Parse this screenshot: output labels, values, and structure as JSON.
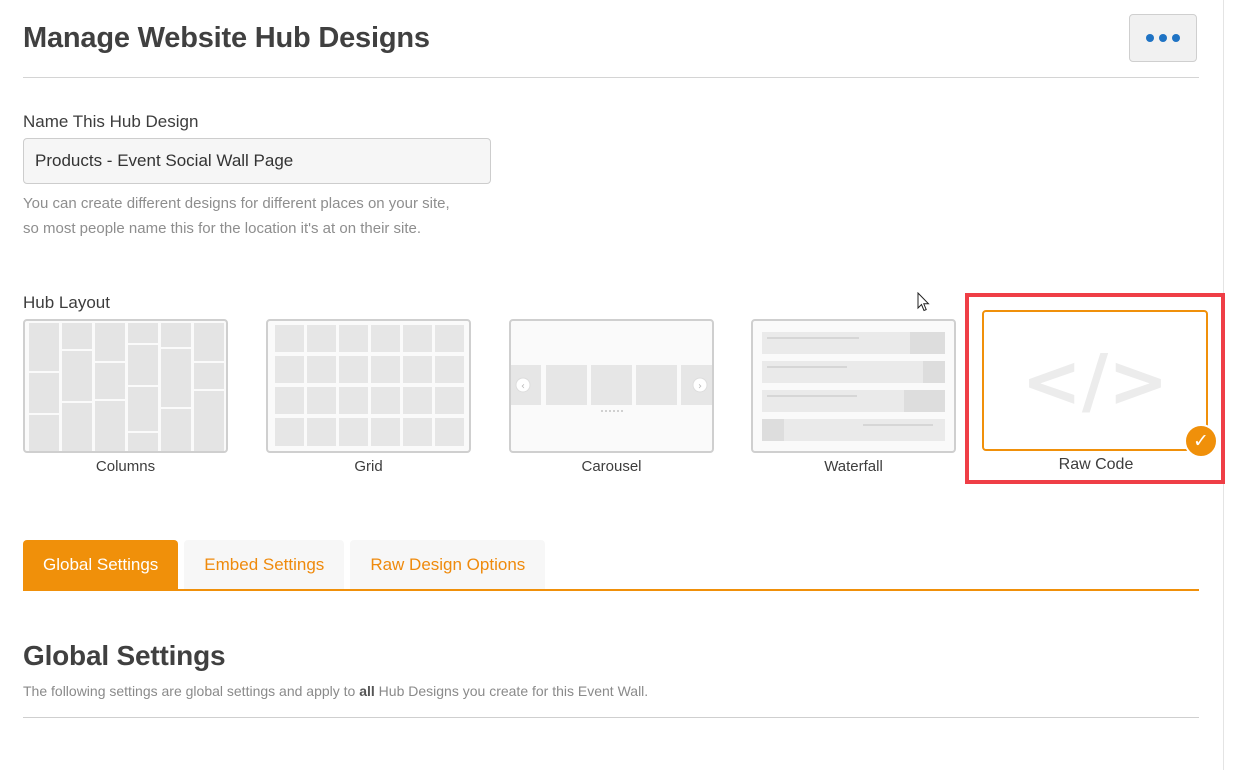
{
  "header": {
    "title": "Manage Website Hub Designs",
    "more_icon": "ellipsis-icon"
  },
  "name_field": {
    "label": "Name This Hub Design",
    "value": "Products - Event Social Wall Page",
    "help_line1": "You can create different designs for different places on your site,",
    "help_line2": "so most people name this for the location it's at on their site."
  },
  "hub_layout": {
    "label": "Hub Layout",
    "options": [
      {
        "label": "Columns",
        "icon": "columns-layout-thumbnail"
      },
      {
        "label": "Grid",
        "icon": "grid-layout-thumbnail"
      },
      {
        "label": "Carousel",
        "icon": "carousel-layout-thumbnail"
      },
      {
        "label": "Waterfall",
        "icon": "waterfall-layout-thumbnail"
      },
      {
        "label": "Raw Code",
        "icon": "code-icon",
        "selected": true
      }
    ],
    "selected_icon": "checkmark-icon"
  },
  "tabs": [
    {
      "label": "Global Settings",
      "active": true
    },
    {
      "label": "Embed Settings",
      "active": false
    },
    {
      "label": "Raw Design Options",
      "active": false
    }
  ],
  "section": {
    "title": "Global Settings",
    "desc_before": "The following settings are global settings and apply to ",
    "desc_bold": "all",
    "desc_after": " Hub Designs you create for this Event Wall."
  },
  "colors": {
    "accent": "#f0900a",
    "highlight": "#ef3e46",
    "link_blue": "#1f73c4"
  }
}
